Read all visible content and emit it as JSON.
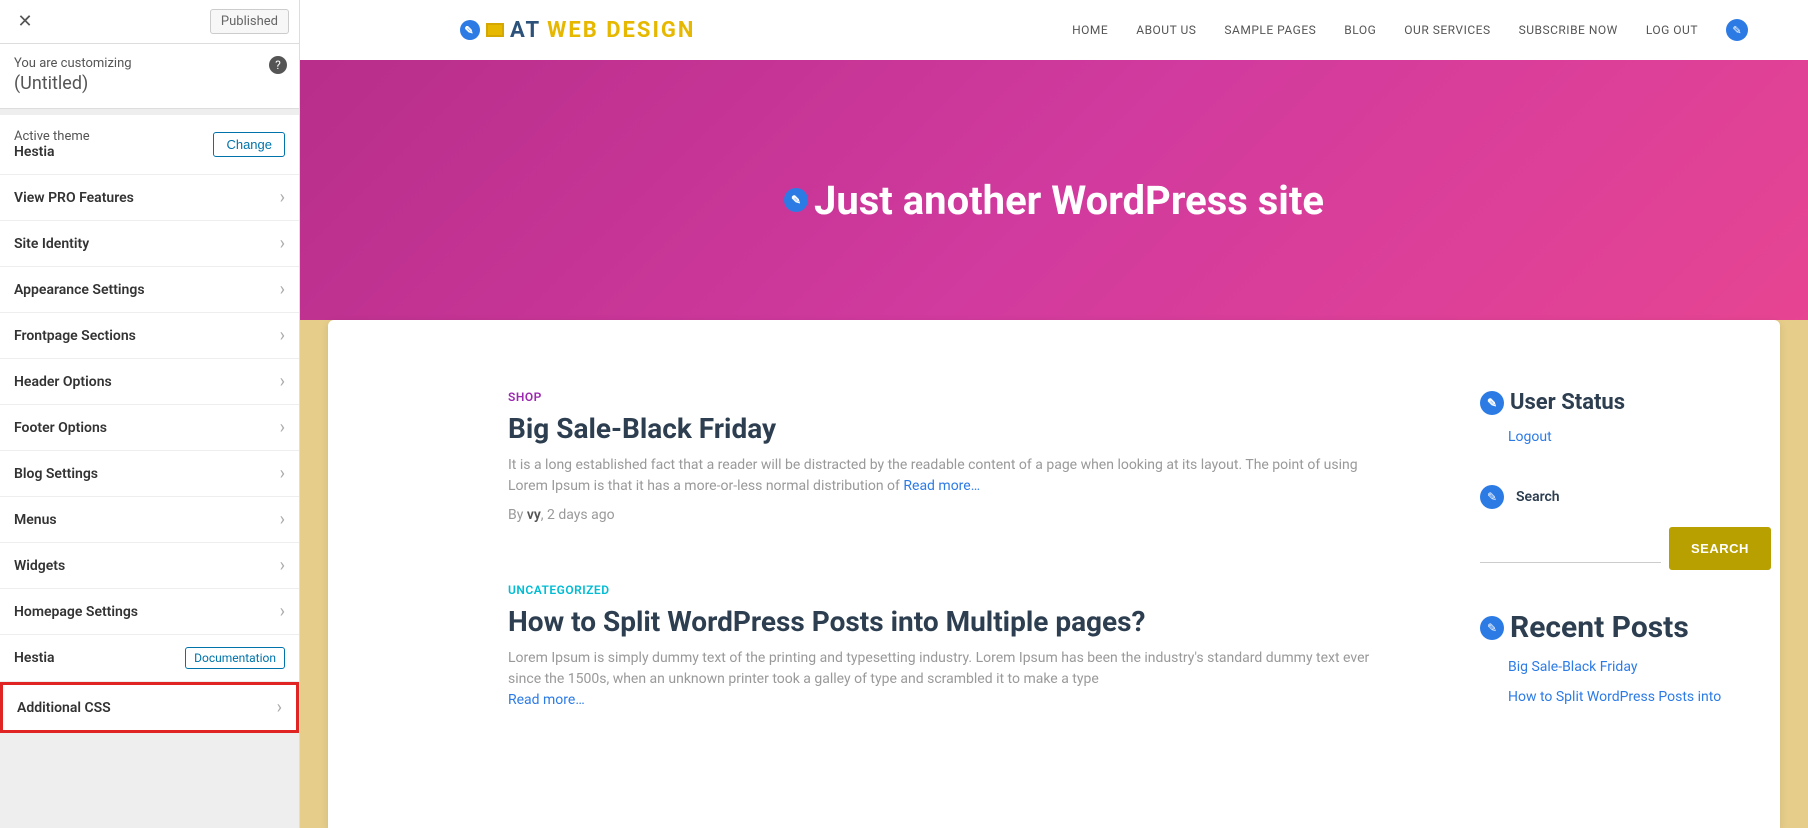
{
  "sidebar": {
    "published": "Published",
    "customizing": "You are customizing",
    "title": "(Untitled)",
    "active_theme_label": "Active theme",
    "active_theme_name": "Hestia",
    "change": "Change",
    "items": [
      {
        "label": "View PRO Features"
      },
      {
        "label": "Site Identity"
      },
      {
        "label": "Appearance Settings"
      },
      {
        "label": "Frontpage Sections"
      },
      {
        "label": "Header Options"
      },
      {
        "label": "Footer Options"
      },
      {
        "label": "Blog Settings"
      },
      {
        "label": "Menus"
      },
      {
        "label": "Widgets"
      },
      {
        "label": "Homepage Settings"
      }
    ],
    "hestia": "Hestia",
    "documentation": "Documentation",
    "additional_css": "Additional CSS"
  },
  "nav": {
    "logo_at": "AT",
    "logo_wd": "WEB DESIGN",
    "links": [
      "HOME",
      "ABOUT US",
      "SAMPLE PAGES",
      "BLOG",
      "OUR SERVICES",
      "SUBSCRIBE NOW",
      "LOG OUT"
    ]
  },
  "hero": {
    "title": "Just another WordPress site"
  },
  "posts": [
    {
      "category": "SHOP",
      "cat_class": "cat-shop",
      "title": "Big Sale-Black Friday",
      "excerpt": "  It is a long established fact that a reader will be distracted by the readable content of a page when looking at its layout. The point of using Lorem Ipsum is that it has a more-or-less normal distribution of ",
      "read_more": "Read more…",
      "by": "By ",
      "author": "vy",
      "date": ", 2 days ago"
    },
    {
      "category": "UNCATEGORIZED",
      "cat_class": "cat-uncat",
      "title": "How to Split WordPress Posts into Multiple pages?",
      "excerpt": "Lorem Ipsum is simply dummy text of the printing and typesetting industry. Lorem Ipsum has been the industry's standard dummy text ever since the 1500s, when an unknown printer took a galley of type and scrambled it to make a type ",
      "read_more": "Read more…"
    }
  ],
  "widgets": {
    "user_status": "User Status",
    "logout": "Logout",
    "search_label": "Search",
    "search_btn": "SEARCH",
    "recent_posts": "Recent Posts",
    "recent_items": [
      "Big Sale-Black Friday",
      "How to Split WordPress Posts into"
    ]
  }
}
